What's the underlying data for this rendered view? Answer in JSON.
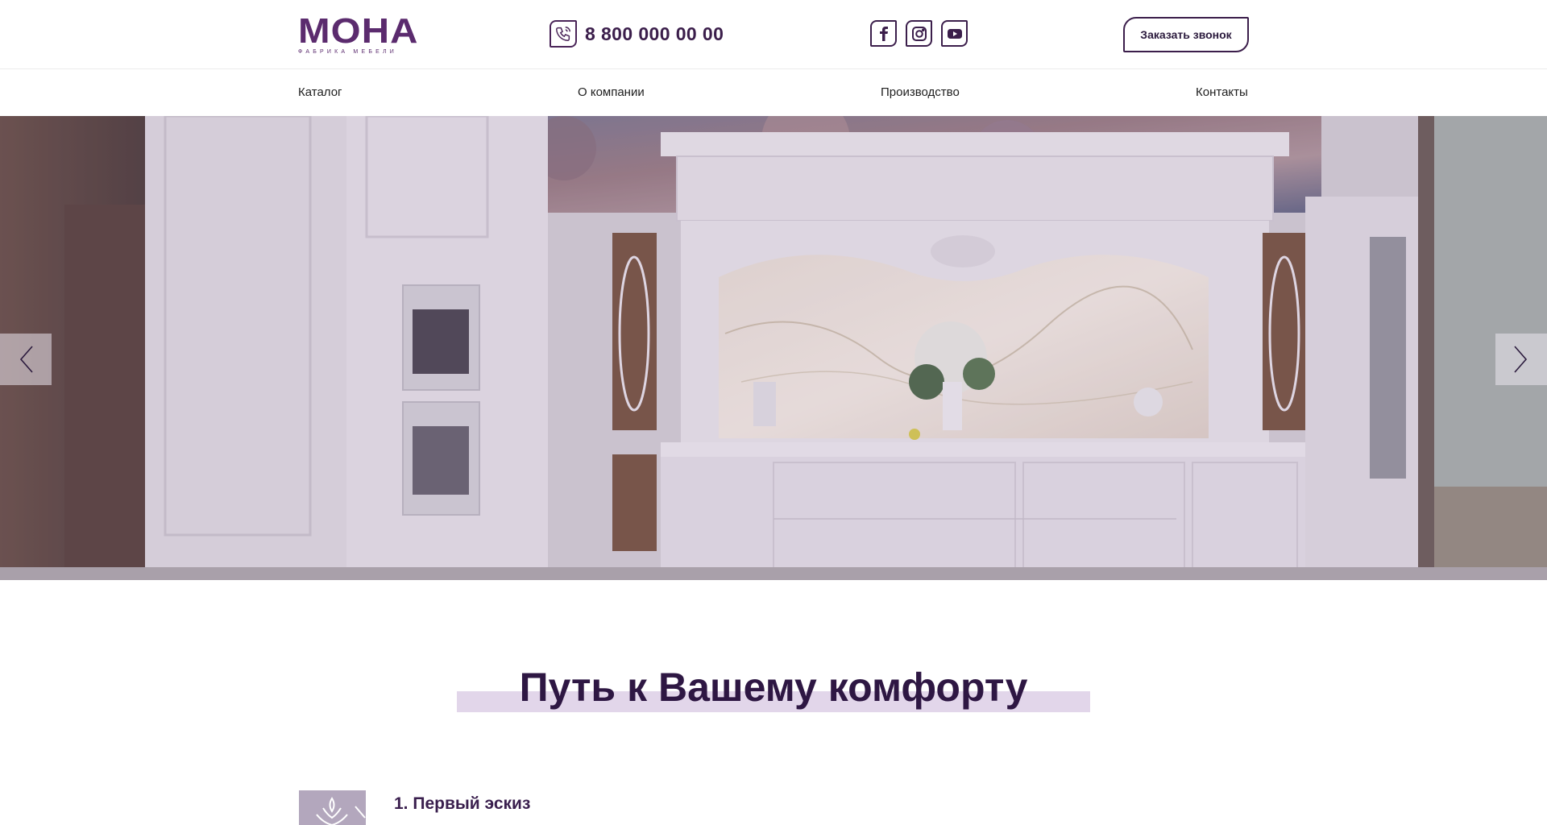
{
  "brand": {
    "name": "МОНА",
    "tagline": "ФАБРИКА МЕБЕЛИ"
  },
  "header": {
    "phone": "8 800 000 00 00",
    "socials": [
      "facebook-icon",
      "instagram-icon",
      "youtube-icon"
    ],
    "callback_label": "Заказать звонок"
  },
  "nav": {
    "items": [
      {
        "label": "Каталог"
      },
      {
        "label": "О компании"
      },
      {
        "label": "Производство"
      },
      {
        "label": "Контакты"
      }
    ]
  },
  "slider": {
    "prev_icon": "chevron-left-icon",
    "next_icon": "chevron-right-icon"
  },
  "section": {
    "title": "Путь к Вашему комфорту",
    "steps": [
      {
        "label": "1. Первый эскиз"
      }
    ]
  },
  "colors": {
    "brand": "#5b2b6e",
    "dark": "#2e1743",
    "title_highlight": "#e2d6ea"
  }
}
